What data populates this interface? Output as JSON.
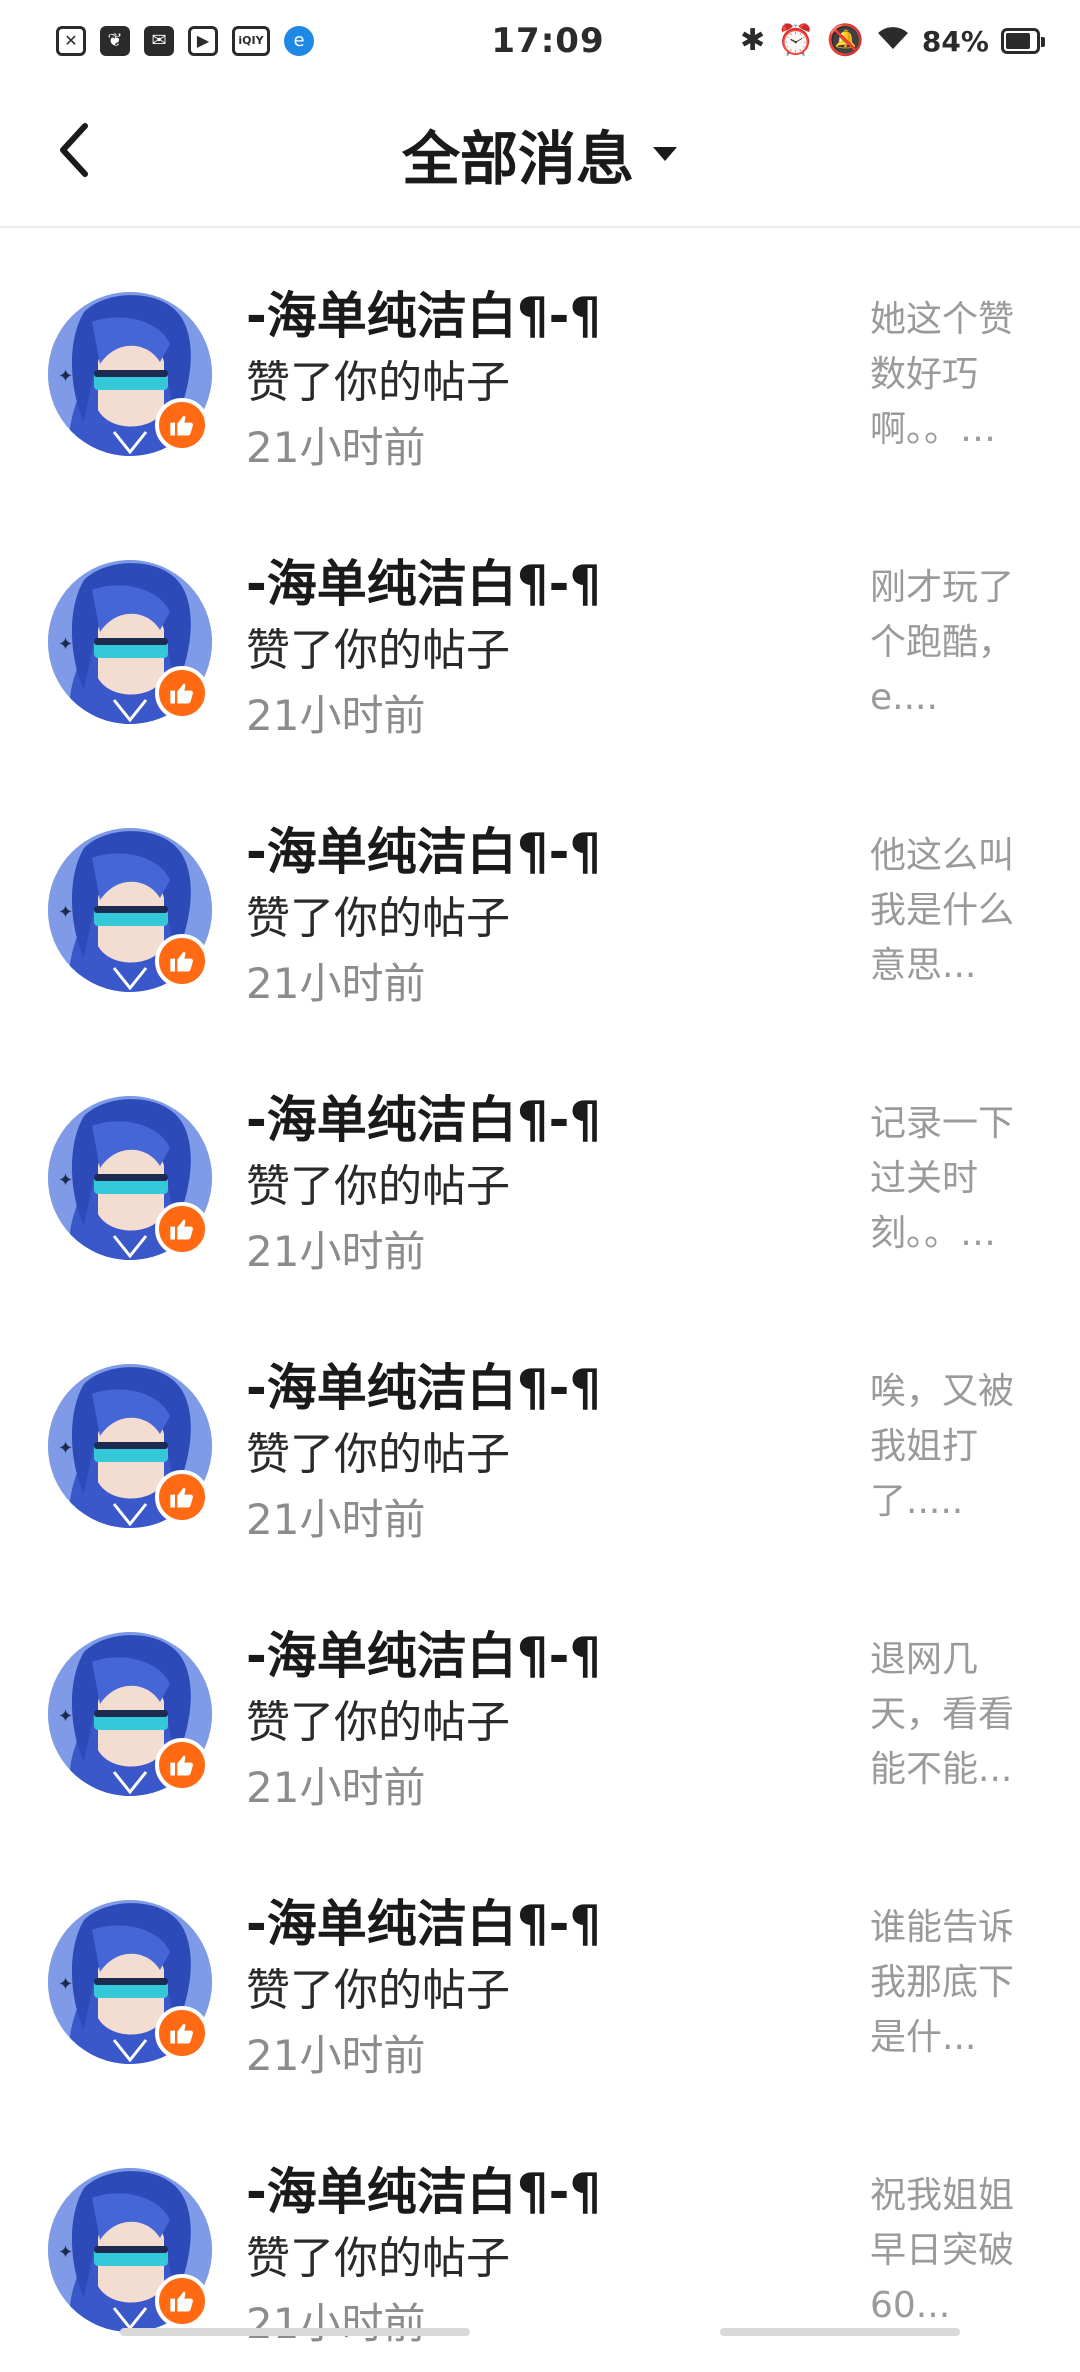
{
  "status_bar": {
    "time": "17:09",
    "battery": "84%",
    "battery_level": 0.84,
    "left_icons": [
      "x-box-icon",
      "leaf-icon",
      "mail-icon",
      "play-icon",
      "iqiyi-icon",
      "edge-icon"
    ],
    "iqiyi_label": "iQIY",
    "right_icons": [
      "bluetooth-icon",
      "alarm-icon",
      "mute-icon",
      "wifi-icon"
    ]
  },
  "header": {
    "title": "全部消息",
    "back_icon": "chevron-left-icon",
    "dropdown_icon": "caret-down-icon"
  },
  "messages": [
    {
      "name": "-海单纯洁白¶-¶",
      "action": "赞了你的帖子",
      "time": "21小时前",
      "preview": "她这个赞\n数好巧\n啊。。…"
    },
    {
      "name": "-海单纯洁白¶-¶",
      "action": "赞了你的帖子",
      "time": "21小时前",
      "preview": "刚才玩了\n个跑酷，\ne...."
    },
    {
      "name": "-海单纯洁白¶-¶",
      "action": "赞了你的帖子",
      "time": "21小时前",
      "preview": "他这么叫\n我是什么\n意思..."
    },
    {
      "name": "-海单纯洁白¶-¶",
      "action": "赞了你的帖子",
      "time": "21小时前",
      "preview": "记录一下\n过关时\n刻。。…"
    },
    {
      "name": "-海单纯洁白¶-¶",
      "action": "赞了你的帖子",
      "time": "21小时前",
      "preview": "唉，又被\n我姐打\n了....."
    },
    {
      "name": "-海单纯洁白¶-¶",
      "action": "赞了你的帖子",
      "time": "21小时前",
      "preview": "退网几\n天，看看\n能不能..."
    },
    {
      "name": "-海单纯洁白¶-¶",
      "action": "赞了你的帖子",
      "time": "21小时前",
      "preview": "谁能告诉\n我那底下\n是什..."
    },
    {
      "name": "-海单纯洁白¶-¶",
      "action": "赞了你的帖子",
      "time": "21小时前",
      "preview": "祝我姐姐\n早日突破\n60..."
    }
  ],
  "colors": {
    "accent_like": "#ff6a13",
    "avatar_bg": "#7f9be8",
    "visor": "#35c8d9"
  }
}
